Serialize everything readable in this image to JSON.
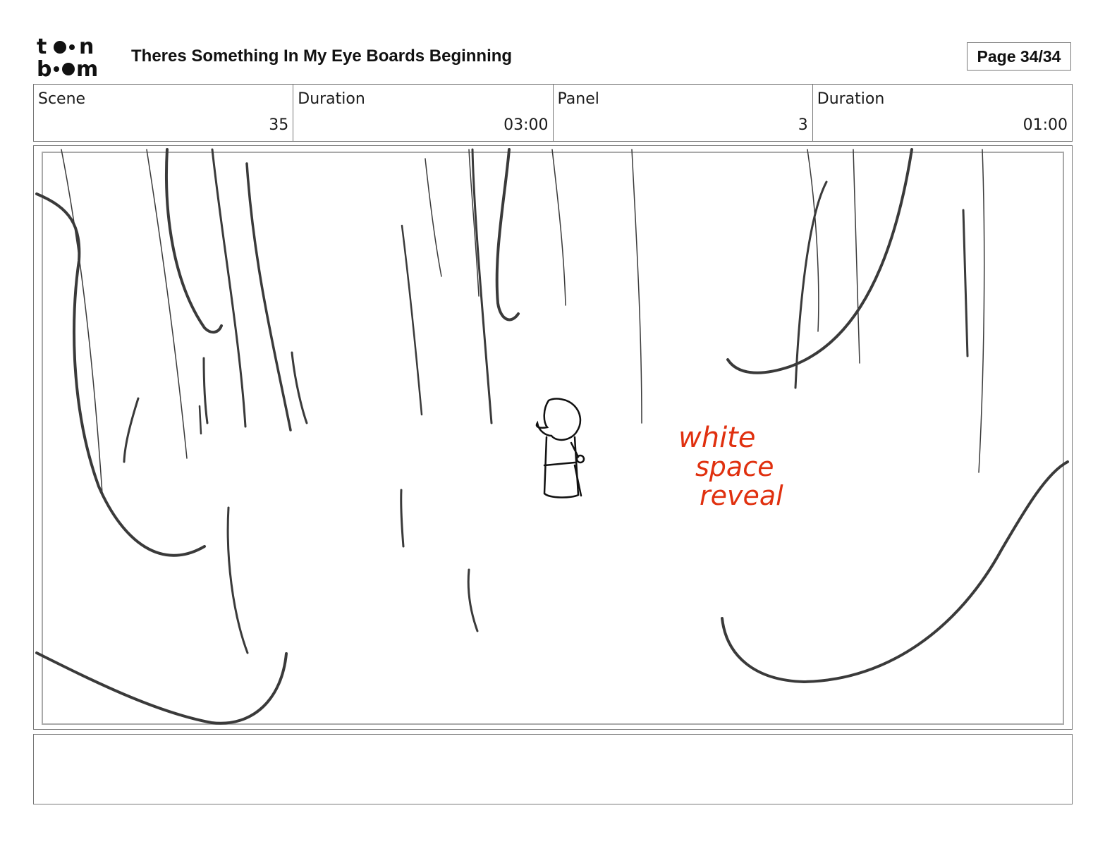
{
  "header": {
    "logo_text_top": "toon",
    "logo_text_bottom": "boom",
    "title": "Theres Something In My Eye Boards Beginning",
    "page": "Page 34/34"
  },
  "info": {
    "scene_label": "Scene",
    "scene_value": "35",
    "scene_duration_label": "Duration",
    "scene_duration_value": "03:00",
    "panel_label": "Panel",
    "panel_value": "3",
    "panel_duration_label": "Duration",
    "panel_duration_value": "01:00"
  },
  "panel": {
    "annotation_line1": "white",
    "annotation_line2": "space",
    "annotation_line3": "reveal",
    "annotation_color": "#e0300f",
    "sketch_color": "#3a3a3a"
  },
  "notes": {
    "text": ""
  }
}
